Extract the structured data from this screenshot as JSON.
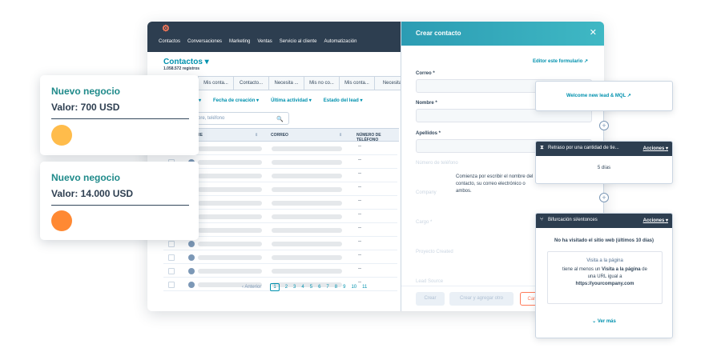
{
  "crm": {
    "nav": [
      "Contactos",
      "Conversaciones",
      "Marketing",
      "Ventas",
      "Servicio al cliente",
      "Automatización"
    ],
    "page_title": "Contactos",
    "record_count": "1.058.572 registros",
    "view_tabs": [
      "Mis conta...",
      "Contacto...",
      "Necesita ...",
      "Mis no co...",
      "Mis conta...",
      "Necesita"
    ],
    "filters": [
      "Fecha de creación",
      "Última actividad",
      "Estado del lead"
    ],
    "search_placeholder": "bre, teléfono",
    "columns": [
      "RE",
      "CORREO",
      "NÚMERO DE TELÉFONO"
    ],
    "pager": {
      "prev": "Anterior",
      "pages": [
        "1",
        "2",
        "3",
        "4",
        "5",
        "6",
        "7",
        "8",
        "9",
        "10",
        "11"
      ]
    }
  },
  "create_panel": {
    "title": "Crear contacto",
    "editor_link": "Editor este formulario",
    "fields": {
      "email": "Correo *",
      "name": "Nombre *",
      "lastname": "Apellidos *",
      "phone": "Número de teléfono",
      "company": "Company",
      "role": "Cargo *",
      "project": "Proyecto Created",
      "lead": "Lead Source"
    },
    "tooltip": "Comienza por escribir el nombre del contacto, su correo electrónico o ambos.",
    "buttons": {
      "create": "Crear",
      "create_another": "Crear y agregar otro",
      "cancel": "Can"
    }
  },
  "deals": [
    {
      "title": "Nuevo negocio",
      "value": "Valor: 700 USD",
      "color": "#ffbc4b"
    },
    {
      "title": "Nuevo negocio",
      "value": "Valor: 14.000 USD",
      "color": "#ff8933"
    }
  ],
  "workflow": {
    "email_action": "Welcome new lead & MQL",
    "delay": {
      "title": "Retraso por una cantidad de tie...",
      "actions": "Acciones",
      "value": "5 días"
    },
    "branch": {
      "title": "Bifurcación si/entonces",
      "actions": "Acciones",
      "condition": "No ha visitado el sitio web (últimos 10 días)",
      "box_title": "Visita a la página",
      "line1": "tiene al menos un",
      "line1_bold": "Visita a la página",
      "line1_end": "de",
      "line2": "una URL igual a",
      "url": "https://yourcompany.com",
      "more": "Ver más"
    }
  }
}
